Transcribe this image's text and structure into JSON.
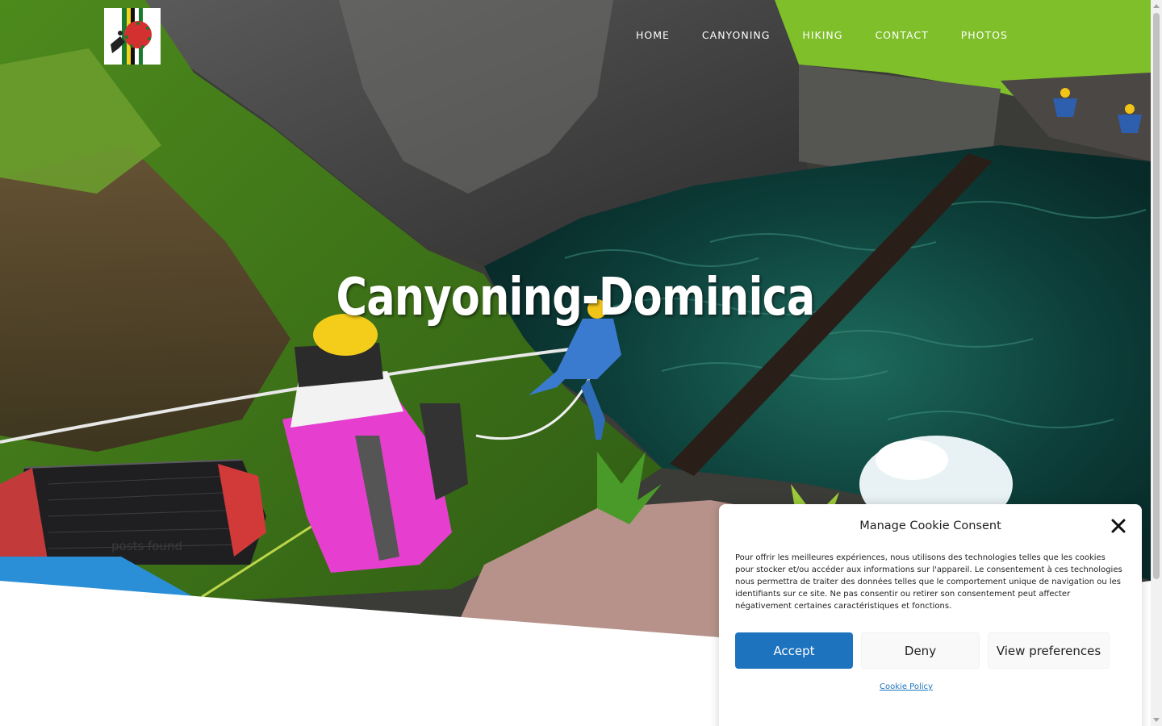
{
  "site": {
    "hero_title": "Canyoning-Dominica",
    "posts_found": "posts found"
  },
  "nav": {
    "items": [
      {
        "label": "HOME"
      },
      {
        "label": "CANYONING"
      },
      {
        "label": "HIKING"
      },
      {
        "label": "CONTACT"
      },
      {
        "label": "PHOTOS"
      }
    ]
  },
  "cookie": {
    "title": "Manage Cookie Consent",
    "text": "Pour offrir les meilleures expériences, nous utilisons des technologies telles que les cookies pour stocker et/ou accéder aux informations sur l'appareil. Le consentement à ces technologies nous permettra de traiter des données telles que le comportement unique de navigation ou les identifiants sur ce site. Ne pas consentir ou retirer son consentement peut affecter négativement certaines caractéristiques et fonctions.",
    "accept_label": "Accept",
    "deny_label": "Deny",
    "preferences_label": "View preferences",
    "policy_label": "Cookie Policy"
  },
  "icons": {
    "close": "close-icon",
    "logo": "canyoning-logo"
  },
  "colors": {
    "accent": "#1e73be",
    "nav_text": "#ffffff"
  }
}
